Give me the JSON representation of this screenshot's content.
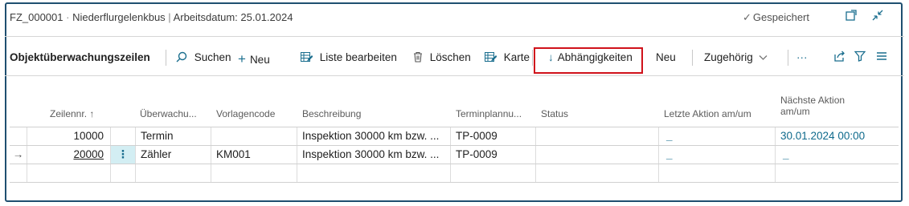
{
  "header": {
    "id": "FZ_000001",
    "separator": " · ",
    "vehicle": "Niederflurgelenkbus",
    "pipe": " | ",
    "workdate_label": "Arbeitsdatum: 25.01.2024",
    "saved_label": "Gespeichert"
  },
  "actionbar": {
    "title": "Objektüberwachungszeilen",
    "search": "Suchen",
    "new": "Neu",
    "edit_list": "Liste bearbeiten",
    "delete": "Löschen",
    "card": "Karte",
    "dependencies": "Abhängigkeiten",
    "new2": "Neu",
    "related": "Zugehörig",
    "more": "···"
  },
  "table": {
    "headers": {
      "line_no": "Zeilennr. ↑",
      "monitoring": "Überwachu...",
      "template": "Vorlagencode",
      "description": "Beschreibung",
      "schedule": "Terminplannu...",
      "status": "Status",
      "last_action": "Letzte Aktion am/um",
      "next_action_1": "Nächste Aktion",
      "next_action_2": "am/um"
    },
    "rows": [
      {
        "marker": "",
        "line_no": "10000",
        "menu": "",
        "monitoring": "Termin",
        "template": "",
        "description": "Inspektion 30000 km bzw. ...",
        "schedule": "TP-0009",
        "status": "",
        "last_action": "_",
        "next_action": "30.01.2024 00:00"
      },
      {
        "marker": "→",
        "line_no": "20000",
        "menu": "⋮",
        "monitoring": "Zähler",
        "template": "KM001",
        "description": "Inspektion 30000 km bzw. ...",
        "schedule": "TP-0009",
        "status": "",
        "last_action": "_",
        "next_action": "_"
      }
    ]
  },
  "colors": {
    "accent": "#1a6e8e",
    "highlight_border": "#d0121b",
    "selected_cell": "#d3eef3",
    "frame": "#1f4f70"
  }
}
